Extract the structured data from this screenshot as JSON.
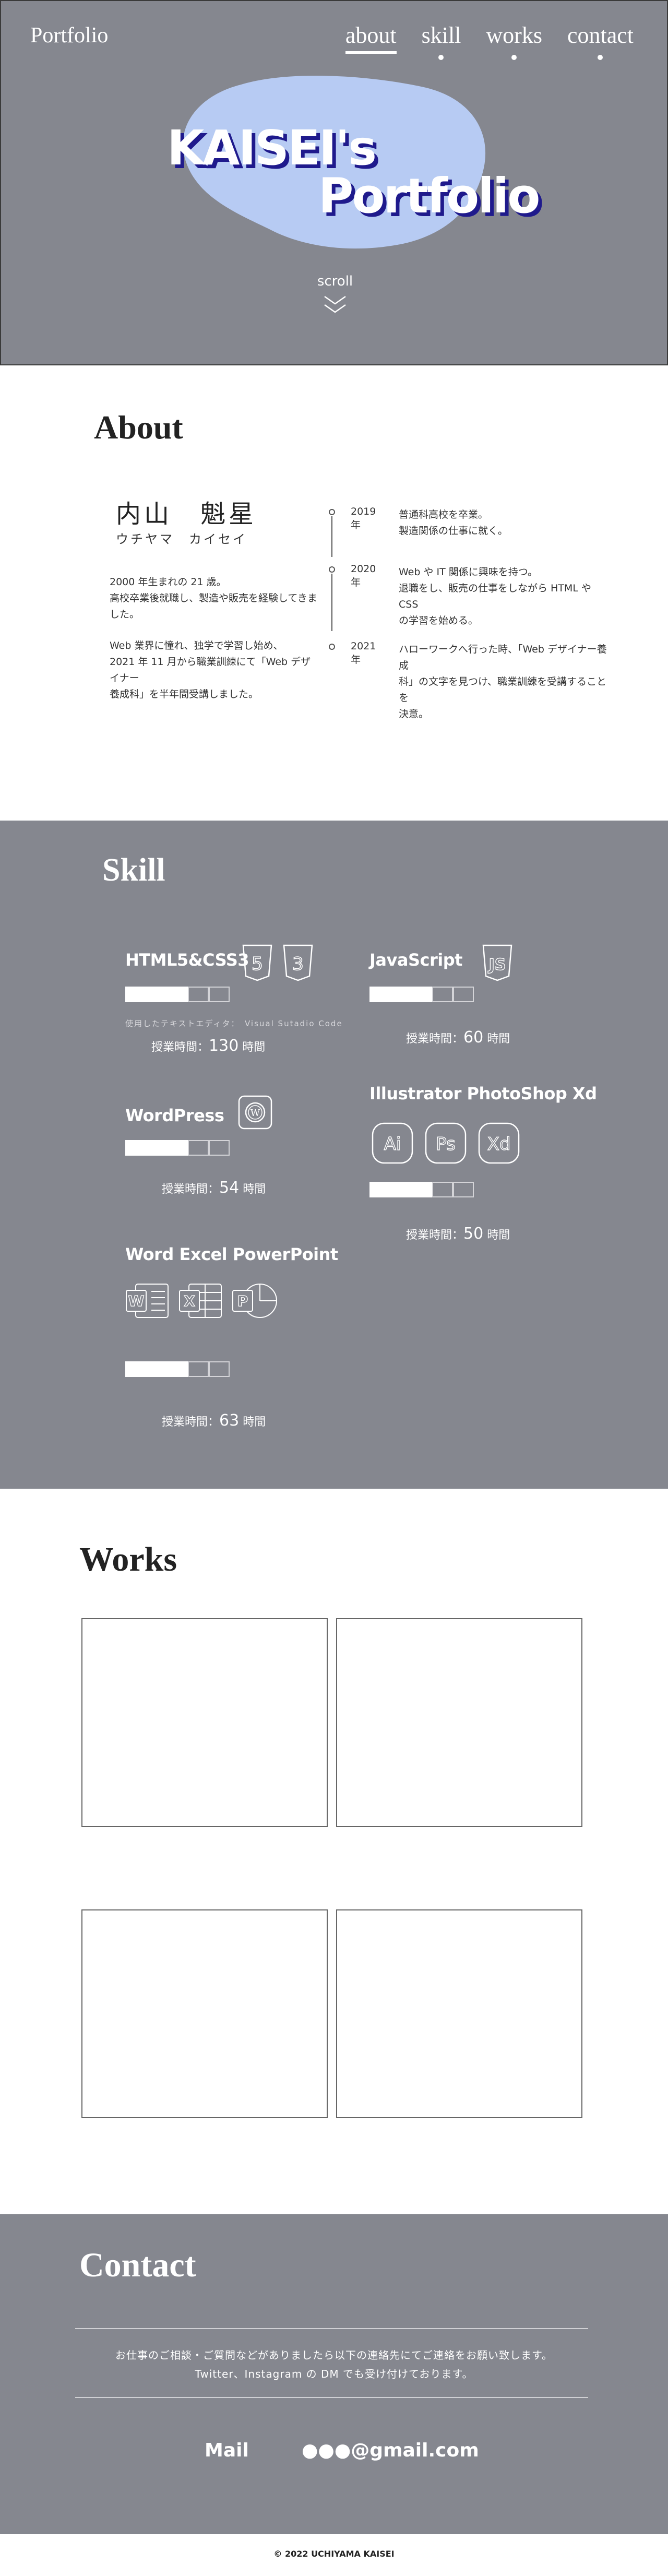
{
  "header": {
    "logo": "Portfolio",
    "nav": [
      {
        "label": "about",
        "active": true
      },
      {
        "label": "skill",
        "active": false
      },
      {
        "label": "works",
        "active": false
      },
      {
        "label": "contact",
        "active": false
      }
    ]
  },
  "hero": {
    "title_line1": "KAISEI's",
    "title_line2": "Portfolio",
    "scroll_label": "scroll",
    "scroll_icon": "double-chevron-down-icon",
    "blob_color": "#b7cbf3",
    "shadow_color": "#1f1a8c"
  },
  "about": {
    "title": "About",
    "name": "内山　魁星",
    "kana": "ウチヤマ　カイセイ",
    "paragraph1": [
      "2000 年生まれの 21 歳。",
      "高校卒業後就職し、製造や販売を経験してきま",
      "した。"
    ],
    "paragraph2": [
      "Web 業界に憧れ、独学で学習し始め、",
      "2021 年 11 月から職業訓練にて「Web デザイナー",
      "養成科」を半年間受講しました。"
    ],
    "timeline": [
      {
        "year": "2019 年",
        "lines": [
          "普通科高校を卒業。",
          "製造関係の仕事に就く。"
        ]
      },
      {
        "year": "2020 年",
        "lines": [
          "Web や IT 関係に興味を持つ。",
          "退職をし、販売の仕事をしながら HTML や CSS",
          "の学習を始める。"
        ]
      },
      {
        "year": "2021 年",
        "lines": [
          "ハローワークへ行った時、「Web デザイナー養成",
          "科」の文字を見つけ、職業訓練を受講することを",
          "決意。"
        ]
      }
    ]
  },
  "skill": {
    "title": "Skill",
    "items": [
      {
        "name": "HTML5&CSS3",
        "level": 3,
        "max": 5,
        "hours_prefix": "授業時間：",
        "hours": "130",
        "hours_suffix": " 時間",
        "editor": "使用したテキストエディタ：　Visual Sutadio Code",
        "icons": [
          "html5-icon",
          "css3-icon"
        ]
      },
      {
        "name": "JavaScript",
        "level": 3,
        "max": 5,
        "hours_prefix": "授業時間：",
        "hours": "60",
        "hours_suffix": " 時間",
        "icons": [
          "javascript-icon"
        ]
      },
      {
        "name": "WordPress",
        "level": 3,
        "max": 5,
        "hours_prefix": "授業時間：",
        "hours": "54",
        "hours_suffix": " 時間",
        "icons": [
          "wordpress-icon"
        ]
      },
      {
        "name": "Illustrator  PhotoShop  Xd",
        "level": 3,
        "max": 5,
        "hours_prefix": "授業時間：",
        "hours": "50",
        "hours_suffix": " 時間",
        "icons": [
          "illustrator-icon",
          "photoshop-icon",
          "xd-icon"
        ],
        "icon_labels": [
          "Ai",
          "Ps",
          "Xd"
        ]
      },
      {
        "name": "Word  Excel  PowerPoint",
        "level": 3,
        "max": 5,
        "hours_prefix": "授業時間：",
        "hours": "63",
        "hours_suffix": " 時間",
        "icons": [
          "word-icon",
          "excel-icon",
          "powerpoint-icon"
        ],
        "icon_labels": [
          "W",
          "X",
          "P"
        ]
      }
    ]
  },
  "works": {
    "title": "Works",
    "cards": 4
  },
  "contact": {
    "title": "Contact",
    "message1": "お仕事のご相談・ご質問などがありましたら以下の連絡先にてご連絡をお願い致します。",
    "message2": "Twitter、Instagram の DM でも受け付けております。",
    "mail_label": "Mail",
    "mail_address": "●●●@gmail.com"
  },
  "footer": {
    "copyright": "© 2022  UCHIYAMA KAISEI"
  },
  "colors": {
    "section_gray": "#85878f",
    "white": "#ffffff"
  }
}
